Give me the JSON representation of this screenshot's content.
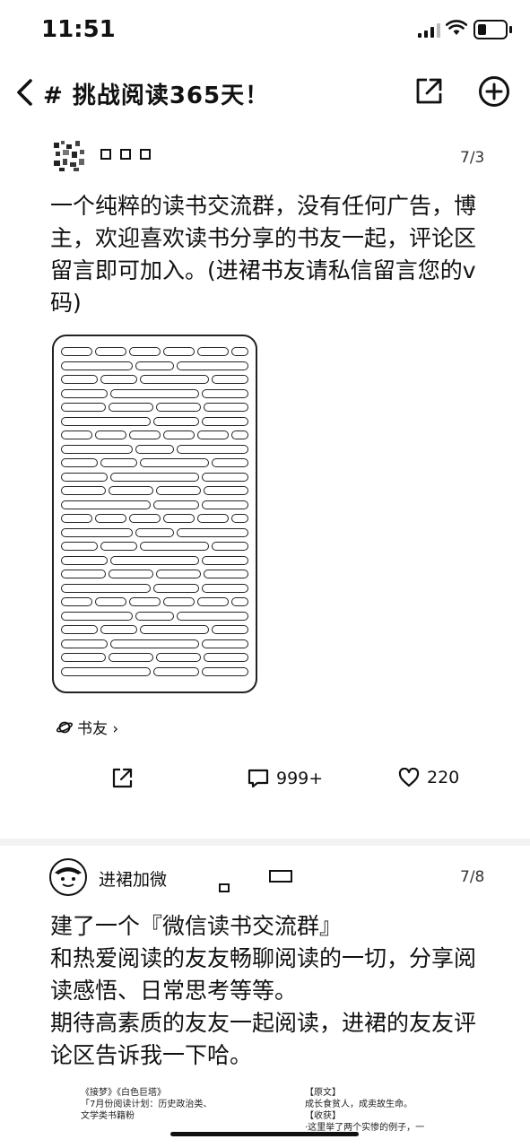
{
  "status_bar": {
    "time": "11:51"
  },
  "nav": {
    "title": "# 挑战阅读365天！"
  },
  "post1": {
    "date": "7/3",
    "text": "一个纯粹的读书交流群，没有任何广告，博主，欢迎喜欢读书分享的书友一起，评论区留言即可加入。(进裙书友请私信留言您的v码)",
    "topic": "书友 ›",
    "comments": "999+",
    "likes": "220"
  },
  "post2": {
    "author": "进裙加微",
    "date": "7/8",
    "lines": [
      "建了一个『微信读书交流群』",
      "和热爱阅读的友友畅聊阅读的一切，分享阅",
      "读感悟、日常思考等等。",
      "期待高素质的友友一起阅读，进裙的友友评",
      "论区告诉我一下哈。"
    ],
    "image_left": [
      "《接梦》《白色巨塔》",
      "「7月份阅读计划：历史政治类、",
      "文学类书籍粉"
    ],
    "image_right": [
      "【原文】",
      "成长食贫人，成卖故生命。",
      "【收获】",
      "·这里举了两个实惨的例子，一"
    ]
  }
}
